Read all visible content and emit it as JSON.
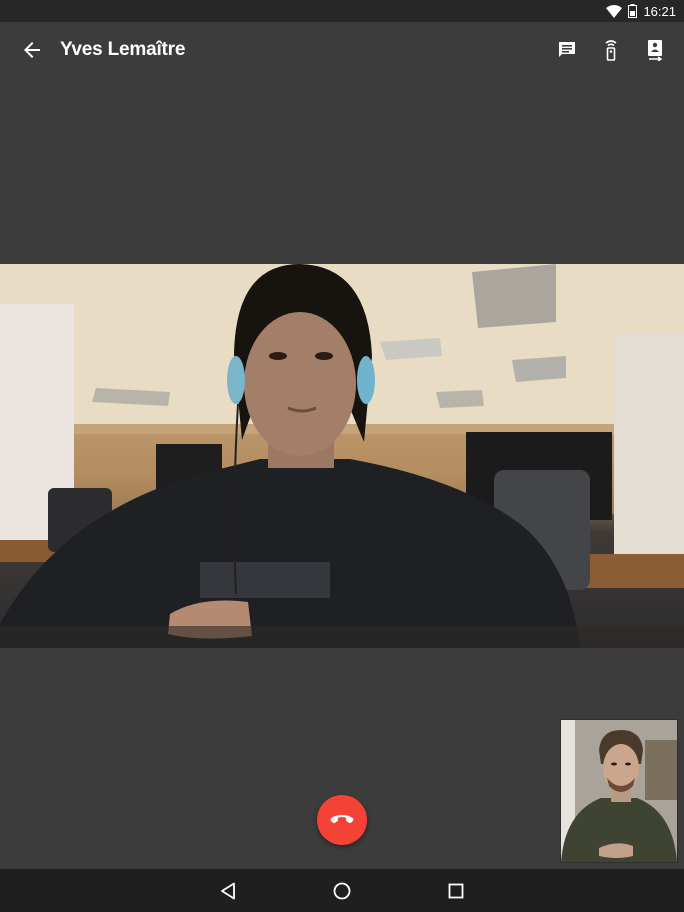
{
  "status_bar": {
    "time": "16:21",
    "icons": [
      "wifi-icon",
      "battery-icon"
    ]
  },
  "app_bar": {
    "back_icon": "arrow-back-icon",
    "title": "Yves Lemaître",
    "actions": [
      {
        "name": "chat-icon"
      },
      {
        "name": "remote-icon"
      },
      {
        "name": "switch-camera-icon"
      }
    ]
  },
  "call": {
    "remote_video_subject": "remote-video",
    "self_view_subject": "self-view",
    "end_call_icon": "phone-hangup-icon",
    "end_call_color": "#f44336"
  },
  "nav_bar": {
    "buttons": [
      "back-triangle-icon",
      "home-circle-icon",
      "recents-square-icon"
    ]
  }
}
